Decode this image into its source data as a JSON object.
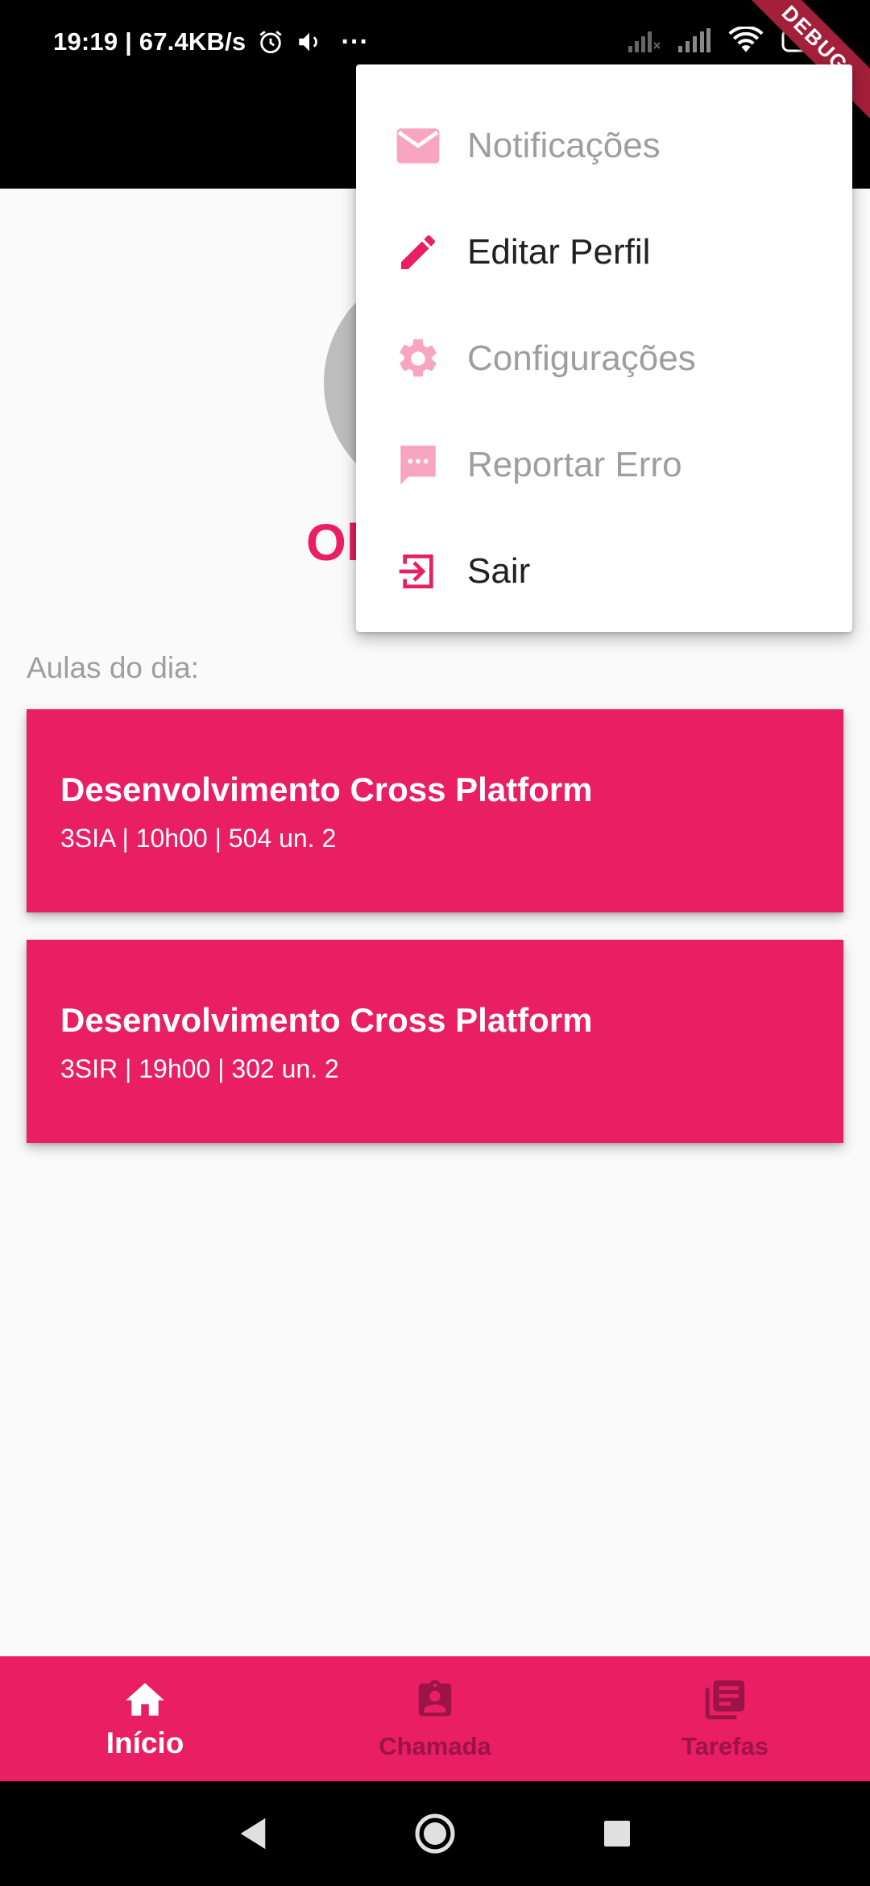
{
  "status_bar": {
    "time_speed": "19:19 | 67.4KB/s",
    "more": "···",
    "icons": [
      "alarm-icon",
      "volume-icon",
      "signal-off-icon",
      "signal-icon",
      "wifi-icon",
      "battery-charging-icon"
    ]
  },
  "debug_banner": "DEBUG",
  "greeting": "Olá",
  "section_label": "Aulas do dia:",
  "classes": [
    {
      "title": "Desenvolvimento Cross Platform",
      "details": "3SIA | 10h00 | 504 un. 2"
    },
    {
      "title": "Desenvolvimento Cross Platform",
      "details": "3SIR | 19h00 | 302 un. 2"
    }
  ],
  "menu": {
    "items": [
      {
        "label": "Notificações",
        "icon": "mail-icon",
        "enabled": false
      },
      {
        "label": "Editar Perfil",
        "icon": "pencil-icon",
        "enabled": true
      },
      {
        "label": "Configurações",
        "icon": "gear-icon",
        "enabled": false
      },
      {
        "label": "Reportar Erro",
        "icon": "feedback-icon",
        "enabled": false
      },
      {
        "label": "Sair",
        "icon": "exit-icon",
        "enabled": true
      }
    ]
  },
  "bottom_nav": {
    "items": [
      {
        "label": "Início",
        "icon": "home-icon",
        "active": true
      },
      {
        "label": "Chamada",
        "icon": "badge-icon",
        "active": false
      },
      {
        "label": "Tarefas",
        "icon": "library-books-icon",
        "active": false
      }
    ]
  },
  "colors": {
    "primary": "#e91e63",
    "primary_light": "#f8a5c2",
    "primary_dark": "#9c1447",
    "background": "#fafafa"
  }
}
